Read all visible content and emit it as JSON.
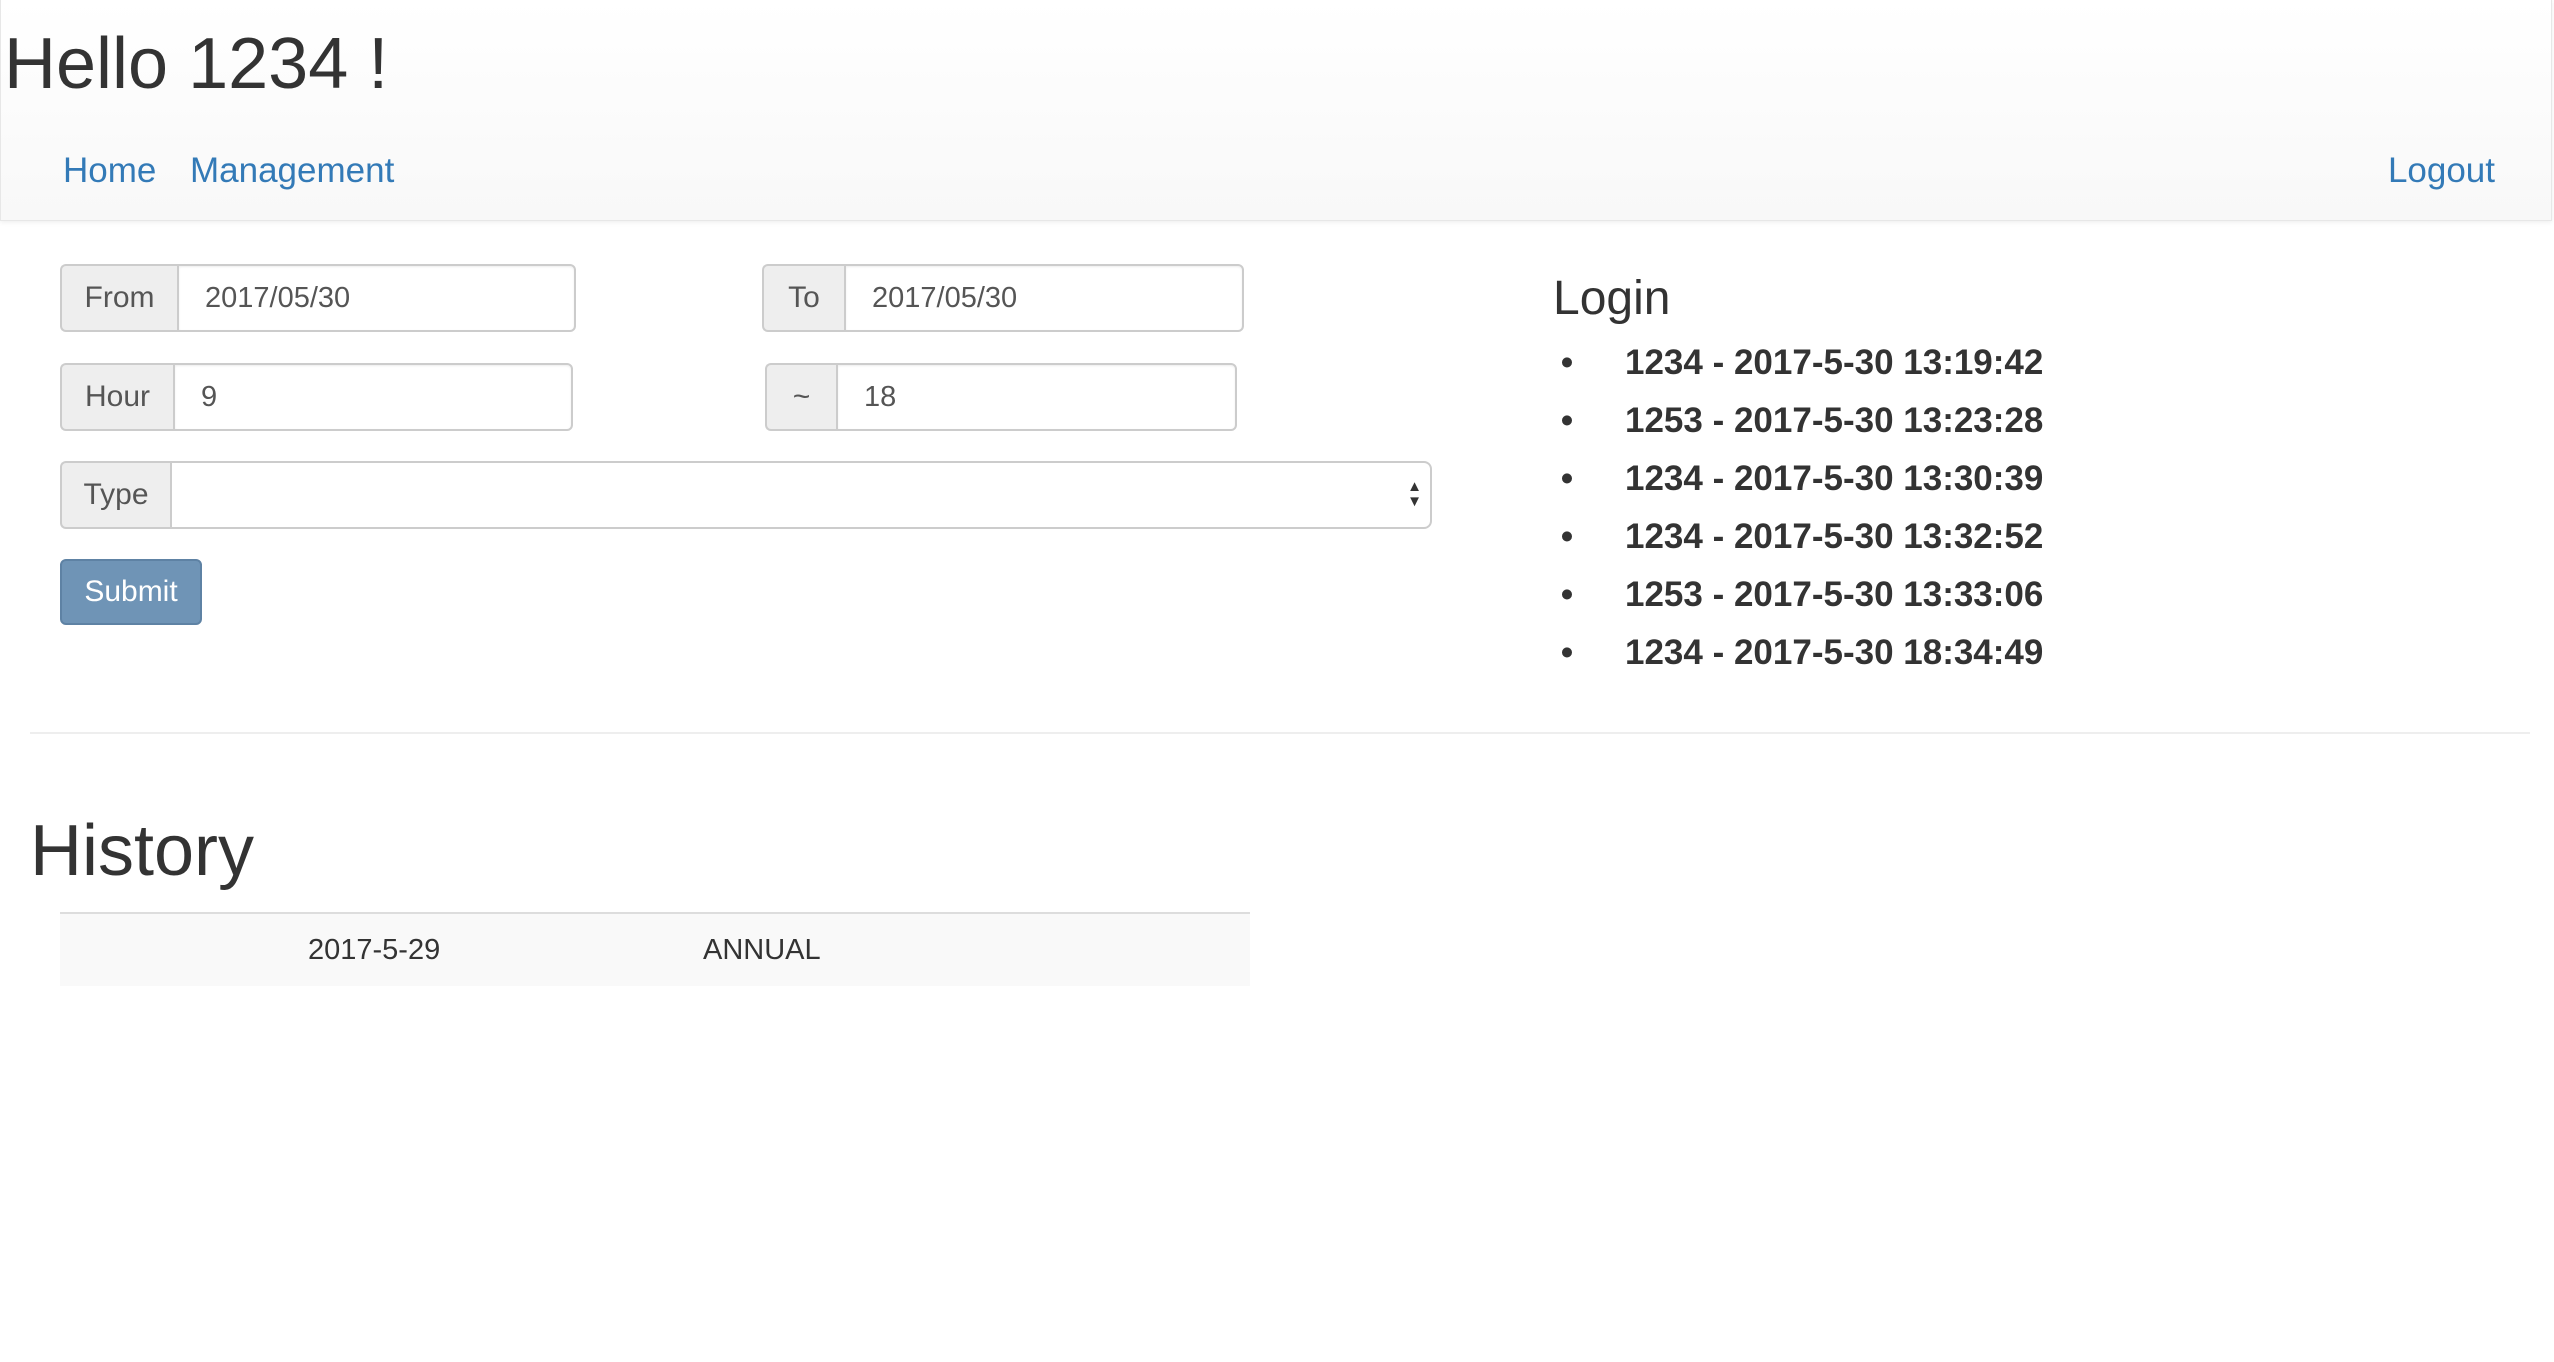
{
  "header": {
    "greeting": "Hello 1234 !",
    "nav": {
      "home": "Home",
      "management": "Management",
      "logout": "Logout"
    }
  },
  "form": {
    "from_label": "From",
    "from_value": "2017/05/30",
    "to_label": "To",
    "to_value": "2017/05/30",
    "hour_label": "Hour",
    "hour_value": "9",
    "hour_sep_label": "~",
    "hour_end_value": "18",
    "type_label": "Type",
    "type_value": "",
    "submit_label": "Submit"
  },
  "login": {
    "title": "Login",
    "entries": [
      "1234 - 2017-5-30 13:19:42",
      "1253 - 2017-5-30 13:23:28",
      "1234 - 2017-5-30 13:30:39",
      "1234 - 2017-5-30 13:32:52",
      "1253 - 2017-5-30 13:33:06",
      "1234 - 2017-5-30 18:34:49"
    ]
  },
  "history": {
    "title": "History",
    "rows": [
      {
        "date": "2017-5-29",
        "type": "ANNUAL"
      }
    ]
  },
  "colors": {
    "link": "#337ab7",
    "submit_bg": "#6f94b6",
    "addon_bg": "#eeeeee",
    "navbar_bg": "#f8f8f8"
  },
  "icons": {
    "select_arrows": "select-arrows-icon",
    "bullet": "bullet-icon"
  }
}
